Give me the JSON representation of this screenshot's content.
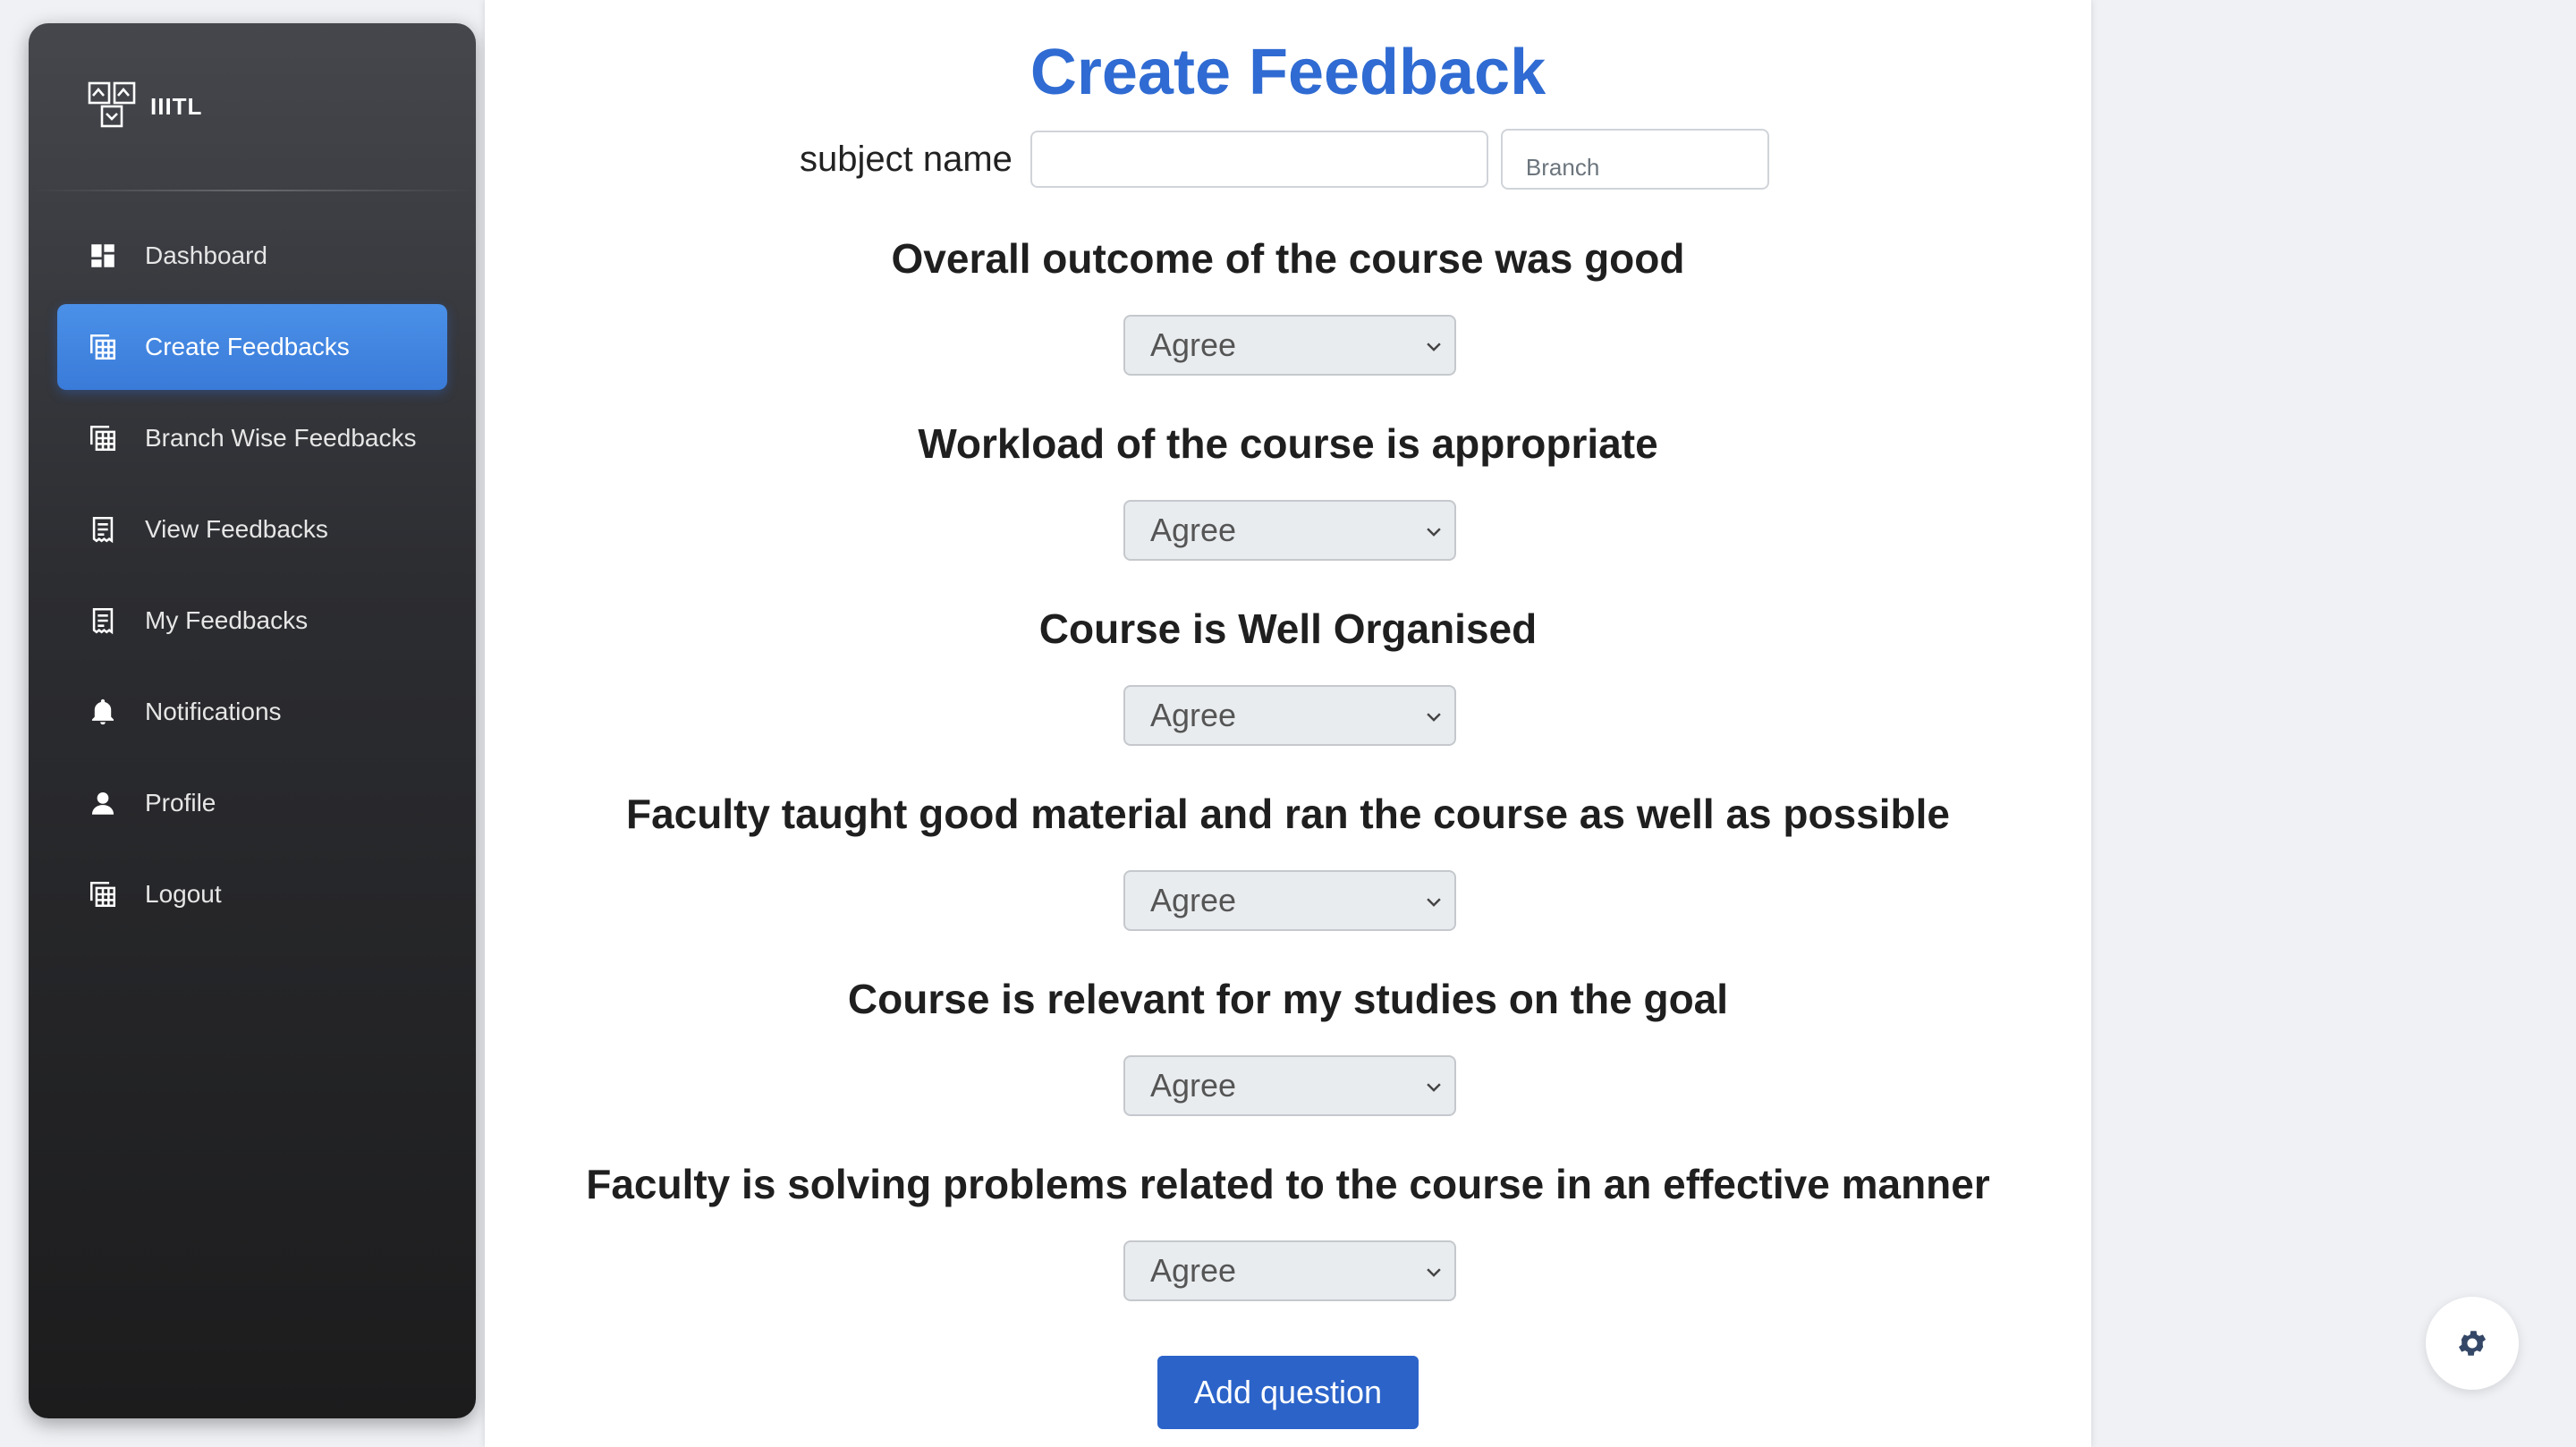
{
  "brand": {
    "name": "IIITL",
    "logo_icon": "iiitl-logo-icon"
  },
  "sidebar": {
    "items": [
      {
        "label": "Dashboard",
        "icon": "dashboard-icon",
        "active": false
      },
      {
        "label": "Create Feedbacks",
        "icon": "table-icon",
        "active": true
      },
      {
        "label": "Branch Wise Feedbacks",
        "icon": "table-icon",
        "active": false
      },
      {
        "label": "View Feedbacks",
        "icon": "receipt-icon",
        "active": false
      },
      {
        "label": "My Feedbacks",
        "icon": "receipt-icon",
        "active": false
      },
      {
        "label": "Notifications",
        "icon": "bell-icon",
        "active": false
      },
      {
        "label": "Profile",
        "icon": "person-icon",
        "active": false
      },
      {
        "label": "Logout",
        "icon": "table-icon",
        "active": false
      }
    ]
  },
  "main": {
    "title": "Create Feedback",
    "subject_label": "subject name",
    "subject_value": "",
    "branch_placeholder": "Branch",
    "questions": [
      {
        "text": "Overall outcome of the course was good",
        "selected": "Agree"
      },
      {
        "text": "Workload of the course is appropriate",
        "selected": "Agree"
      },
      {
        "text": "Course is Well Organised",
        "selected": "Agree"
      },
      {
        "text": "Faculty taught good material and ran the course as well as possible",
        "selected": "Agree"
      },
      {
        "text": "Course is relevant for my studies on the goal",
        "selected": "Agree"
      },
      {
        "text": "Faculty is solving problems related to the course in an effective manner",
        "selected": "Agree"
      }
    ],
    "add_button_label": "Add question"
  },
  "floating": {
    "icon": "gear-icon"
  },
  "colors": {
    "accent": "#2f6bd2",
    "active_nav": "#3f85e3",
    "button": "#2b63c9"
  }
}
